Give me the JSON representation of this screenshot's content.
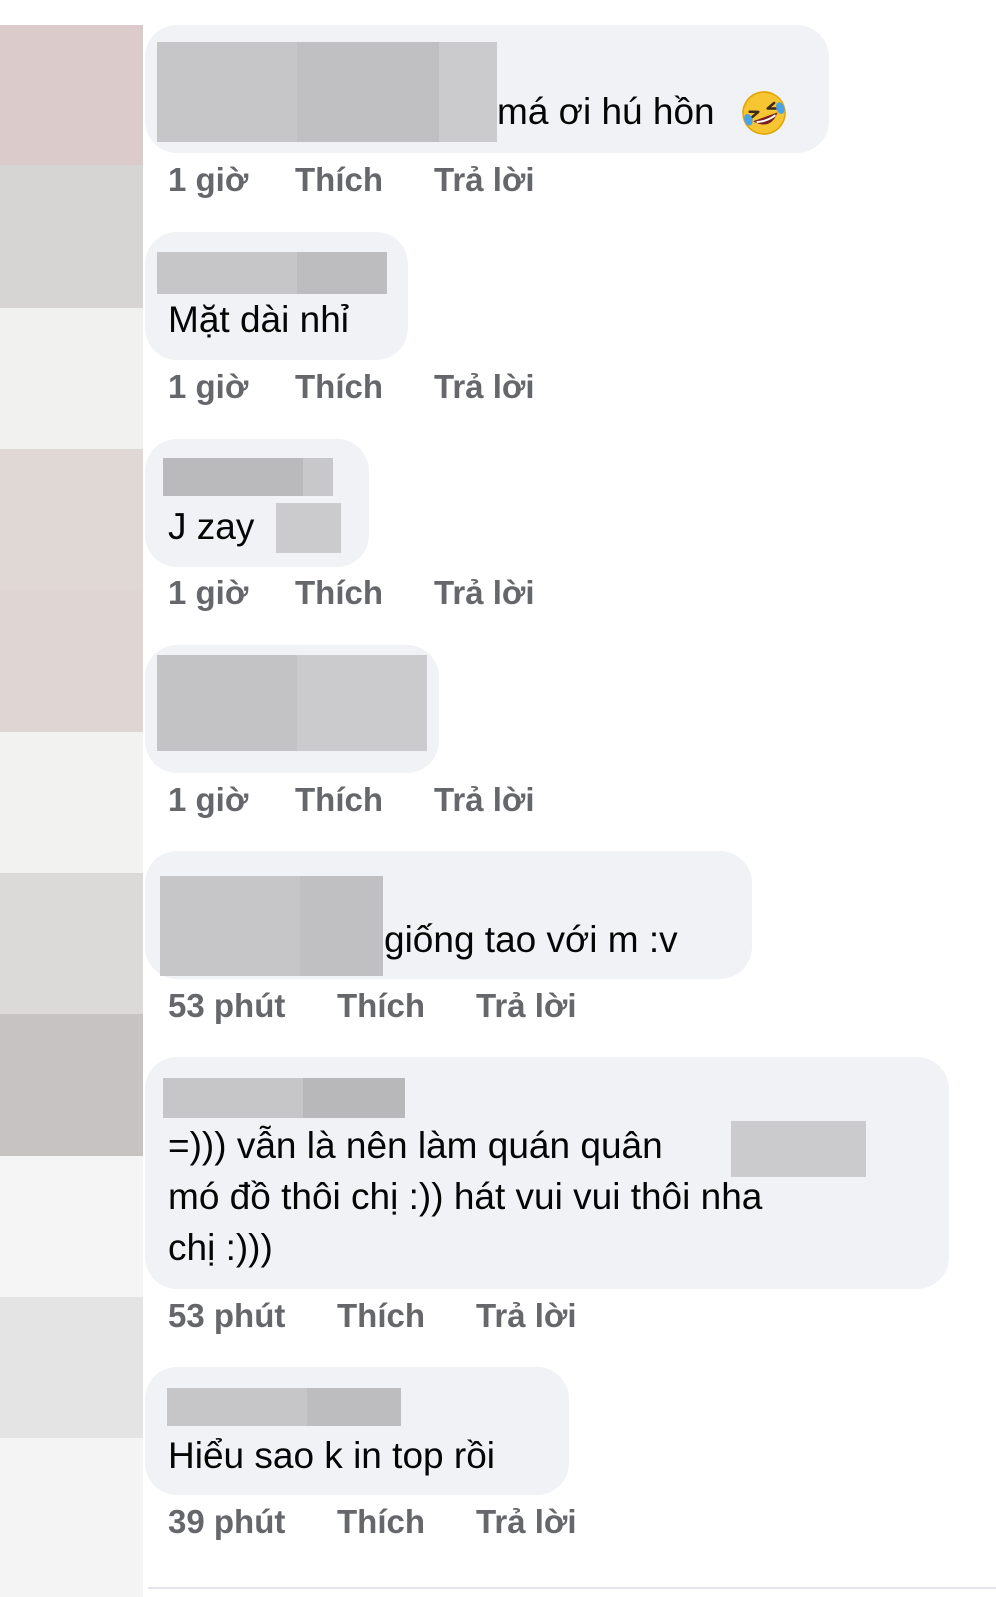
{
  "comments": [
    {
      "text": "má ơi hú hồn",
      "emoji": "rolling-on-floor-laughing",
      "time": "1 giờ",
      "like_label": "Thích",
      "reply_label": "Trả lời"
    },
    {
      "text": "Mặt dài nhỉ",
      "time": "1 giờ",
      "like_label": "Thích",
      "reply_label": "Trả lời"
    },
    {
      "text": "J zay",
      "time": "1 giờ",
      "like_label": "Thích",
      "reply_label": "Trả lời"
    },
    {
      "text": "",
      "time": "1 giờ",
      "like_label": "Thích",
      "reply_label": "Trả lời"
    },
    {
      "text": "giống tao với m :v",
      "time": "53 phút",
      "like_label": "Thích",
      "reply_label": "Trả lời"
    },
    {
      "text_lines": [
        "=))) vẫn là nên làm quán quân",
        "mó đồ thôi chị :)) hát vui vui thôi nha",
        "chị :)))"
      ],
      "time": "53 phút",
      "like_label": "Thích",
      "reply_label": "Trả lời"
    },
    {
      "text": "Hiểu sao k in top rồi",
      "time": "39 phút",
      "like_label": "Thích",
      "reply_label": "Trả lời"
    }
  ],
  "colors": {
    "bubble_bg": "#f0f2f5",
    "meta_text": "#65676b",
    "comment_text": "#050505",
    "redaction": "#c4c4c8"
  }
}
